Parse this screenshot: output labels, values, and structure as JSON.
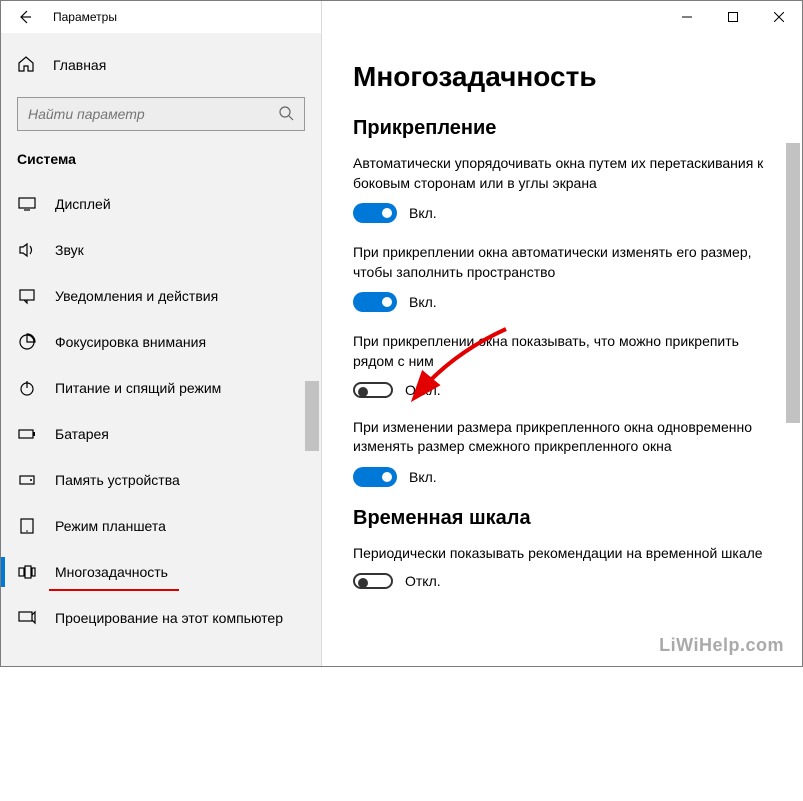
{
  "titlebar": {
    "title": "Параметры"
  },
  "sidebar": {
    "home": "Главная",
    "search_placeholder": "Найти параметр",
    "category": "Система",
    "items": [
      {
        "label": "Дисплей",
        "icon": "display"
      },
      {
        "label": "Звук",
        "icon": "sound"
      },
      {
        "label": "Уведомления и действия",
        "icon": "notifications"
      },
      {
        "label": "Фокусировка внимания",
        "icon": "focus"
      },
      {
        "label": "Питание и спящий режим",
        "icon": "power"
      },
      {
        "label": "Батарея",
        "icon": "battery"
      },
      {
        "label": "Память устройства",
        "icon": "storage"
      },
      {
        "label": "Режим планшета",
        "icon": "tablet"
      },
      {
        "label": "Многозадачность",
        "icon": "multitask",
        "selected": true
      },
      {
        "label": "Проецирование на этот компьютер",
        "icon": "project"
      }
    ]
  },
  "main": {
    "title": "Многозадачность",
    "sections": [
      {
        "title": "Прикрепление",
        "settings": [
          {
            "desc": "Автоматически упорядочивать окна путем их перетаскивания к боковым сторонам или в углы экрана",
            "on": true,
            "state_label": "Вкл."
          },
          {
            "desc": "При прикреплении окна автоматически изменять его размер, чтобы заполнить пространство",
            "on": true,
            "state_label": "Вкл."
          },
          {
            "desc": "При прикреплении окна показывать, что можно прикрепить рядом с ним",
            "on": false,
            "state_label": "Откл."
          },
          {
            "desc": "При изменении размера прикрепленного окна одновременно изменять размер смежного прикрепленного окна",
            "on": true,
            "state_label": "Вкл."
          }
        ]
      },
      {
        "title": "Временная шкала",
        "settings": [
          {
            "desc": "Периодически показывать рекомендации на временной шкале",
            "on": false,
            "state_label": "Откл."
          }
        ]
      }
    ]
  },
  "watermark": "LiWiHelp.com"
}
